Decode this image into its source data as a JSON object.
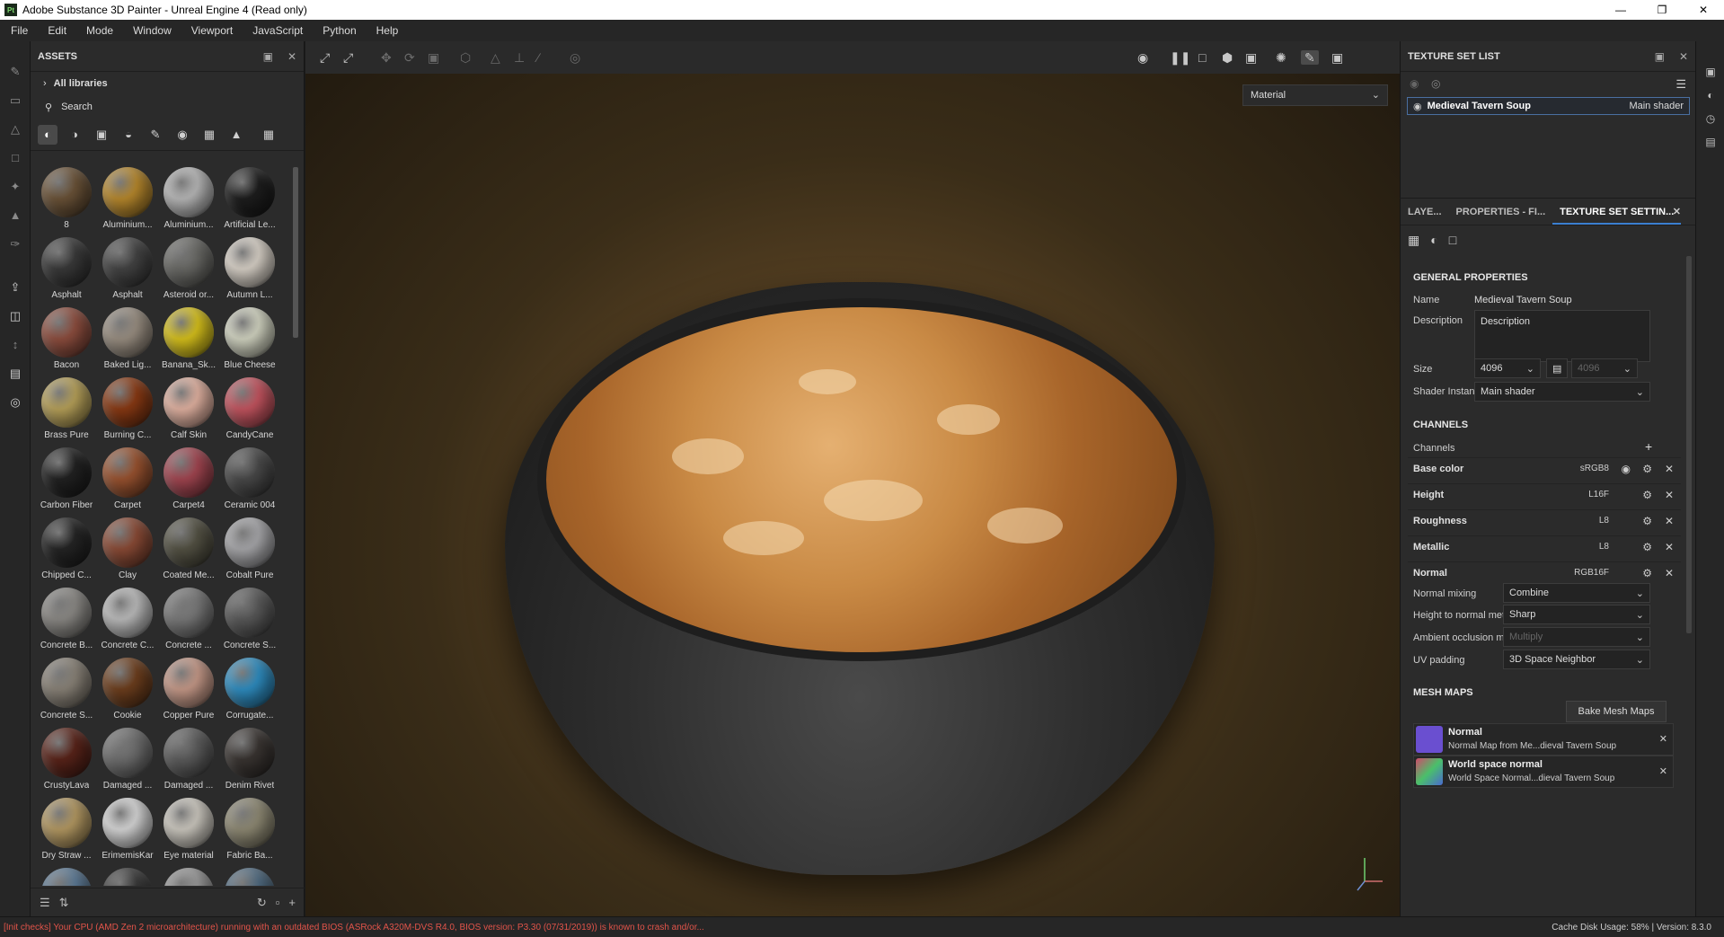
{
  "window": {
    "title": "Adobe Substance 3D Painter - Unreal Engine 4 (Read only)",
    "icon": "Pt"
  },
  "menu": [
    "File",
    "Edit",
    "Mode",
    "Window",
    "Viewport",
    "JavaScript",
    "Python",
    "Help"
  ],
  "assets": {
    "title": "ASSETS",
    "breadcrumb": "All libraries",
    "search_placeholder": "Search",
    "items": [
      {
        "label": "8",
        "color": "#6b5338"
      },
      {
        "label": "Aluminium...",
        "color": "#b8892d"
      },
      {
        "label": "Aluminium...",
        "color": "#b9b9b9"
      },
      {
        "label": "Artificial Le...",
        "color": "#1e1e1e"
      },
      {
        "label": "Asphalt",
        "color": "#3a3a3a"
      },
      {
        "label": "Asphalt",
        "color": "#444444"
      },
      {
        "label": "Asteroid or...",
        "color": "#6a6a66"
      },
      {
        "label": "Autumn L...",
        "color": "#d9d2c8"
      },
      {
        "label": "Bacon",
        "color": "#8e4e3f"
      },
      {
        "label": "Baked Lig...",
        "color": "#9a8f82"
      },
      {
        "label": "Banana_Sk...",
        "color": "#d8c21c"
      },
      {
        "label": "Blue Cheese",
        "color": "#d3d5c2"
      },
      {
        "label": "Brass Pure",
        "color": "#b8a25a"
      },
      {
        "label": "Burning C...",
        "color": "#8a3a14"
      },
      {
        "label": "Calf Skin",
        "color": "#e3b3a2"
      },
      {
        "label": "CandyCane",
        "color": "#c55560"
      },
      {
        "label": "Carbon Fiber",
        "color": "#222222"
      },
      {
        "label": "Carpet",
        "color": "#9a5330"
      },
      {
        "label": "Carpet4",
        "color": "#a34651"
      },
      {
        "label": "Ceramic 004",
        "color": "#4a4a4a"
      },
      {
        "label": "Chipped C...",
        "color": "#252525"
      },
      {
        "label": "Clay",
        "color": "#8b4b36"
      },
      {
        "label": "Coated Me...",
        "color": "#545244"
      },
      {
        "label": "Cobalt Pure",
        "color": "#a8a8ab"
      },
      {
        "label": "Concrete B...",
        "color": "#8c8a86"
      },
      {
        "label": "Concrete C...",
        "color": "#bdbdbd"
      },
      {
        "label": "Concrete ...",
        "color": "#7a7a7a"
      },
      {
        "label": "Concrete S...",
        "color": "#5a5a5a"
      },
      {
        "label": "Concrete S...",
        "color": "#8a8378"
      },
      {
        "label": "Cookie",
        "color": "#6e3f1e"
      },
      {
        "label": "Copper Pure",
        "color": "#c79a89"
      },
      {
        "label": "Corrugate...",
        "color": "#2f8ec2"
      },
      {
        "label": "CrustyLava",
        "color": "#5a241a"
      },
      {
        "label": "Damaged ...",
        "color": "#6f6f6f"
      },
      {
        "label": "Damaged ...",
        "color": "#5d5d5d"
      },
      {
        "label": "Denim Rivet",
        "color": "#3a3532"
      },
      {
        "label": "Dry Straw ...",
        "color": "#b59a63"
      },
      {
        "label": "ErimemisKar",
        "color": "#d8d8d8"
      },
      {
        "label": "Eye material",
        "color": "#cdc9c0"
      },
      {
        "label": "Fabric Ba...",
        "color": "#8f8a74"
      },
      {
        "label": "",
        "color": "#5c7a96"
      },
      {
        "label": "",
        "color": "#3a3a3a"
      },
      {
        "label": "",
        "color": "#9a9a9a"
      },
      {
        "label": "",
        "color": "#4f6a80"
      }
    ]
  },
  "viewport": {
    "shading_mode": "Material"
  },
  "texture_set_list": {
    "title": "TEXTURE SET LIST",
    "set_name": "Medieval Tavern Soup",
    "shader": "Main shader"
  },
  "panel_tabs": [
    "LAYE...",
    "PROPERTIES - FI...",
    "TEXTURE SET SETTIN..."
  ],
  "settings": {
    "general_title": "GENERAL PROPERTIES",
    "name_label": "Name",
    "name_value": "Medieval Tavern Soup",
    "description_label": "Description",
    "description_value": "Description",
    "size_label": "Size",
    "size_value": "4096",
    "size_value2": "4096",
    "shader_instance_label": "Shader Instance",
    "shader_instance_value": "Main shader",
    "channels_title": "CHANNELS",
    "channels_label": "Channels",
    "channels": [
      {
        "name": "Base color",
        "format": "sRGB8"
      },
      {
        "name": "Height",
        "format": "L16F"
      },
      {
        "name": "Roughness",
        "format": "L8"
      },
      {
        "name": "Metallic",
        "format": "L8"
      },
      {
        "name": "Normal",
        "format": "RGB16F"
      }
    ],
    "normal_mixing_label": "Normal mixing",
    "normal_mixing_value": "Combine",
    "height_to_normal_label": "Height to normal method",
    "height_to_normal_value": "Sharp",
    "ao_mixing_label": "Ambient occlusion mixing",
    "ao_mixing_value": "Multiply",
    "uv_padding_label": "UV padding",
    "uv_padding_value": "3D Space Neighbor",
    "mesh_maps_title": "MESH MAPS",
    "bake_button": "Bake Mesh Maps",
    "mesh_maps": [
      {
        "name": "Normal",
        "desc": "Normal Map from Me...dieval Tavern Soup"
      },
      {
        "name": "World space normal",
        "desc": "World Space Normal...dieval Tavern Soup"
      }
    ]
  },
  "status": {
    "error": "[Init checks] Your CPU (AMD Zen 2 microarchitecture) running with an outdated BIOS (ASRock A320M-DVS R4.0, BIOS version: P3.30 (07/31/2019)) is known to crash and/or...",
    "cache": "Cache Disk Usage:   58% | Version: 8.3.0"
  },
  "colors": {
    "accent": "#3b7fd0",
    "error": "#e2544a"
  }
}
